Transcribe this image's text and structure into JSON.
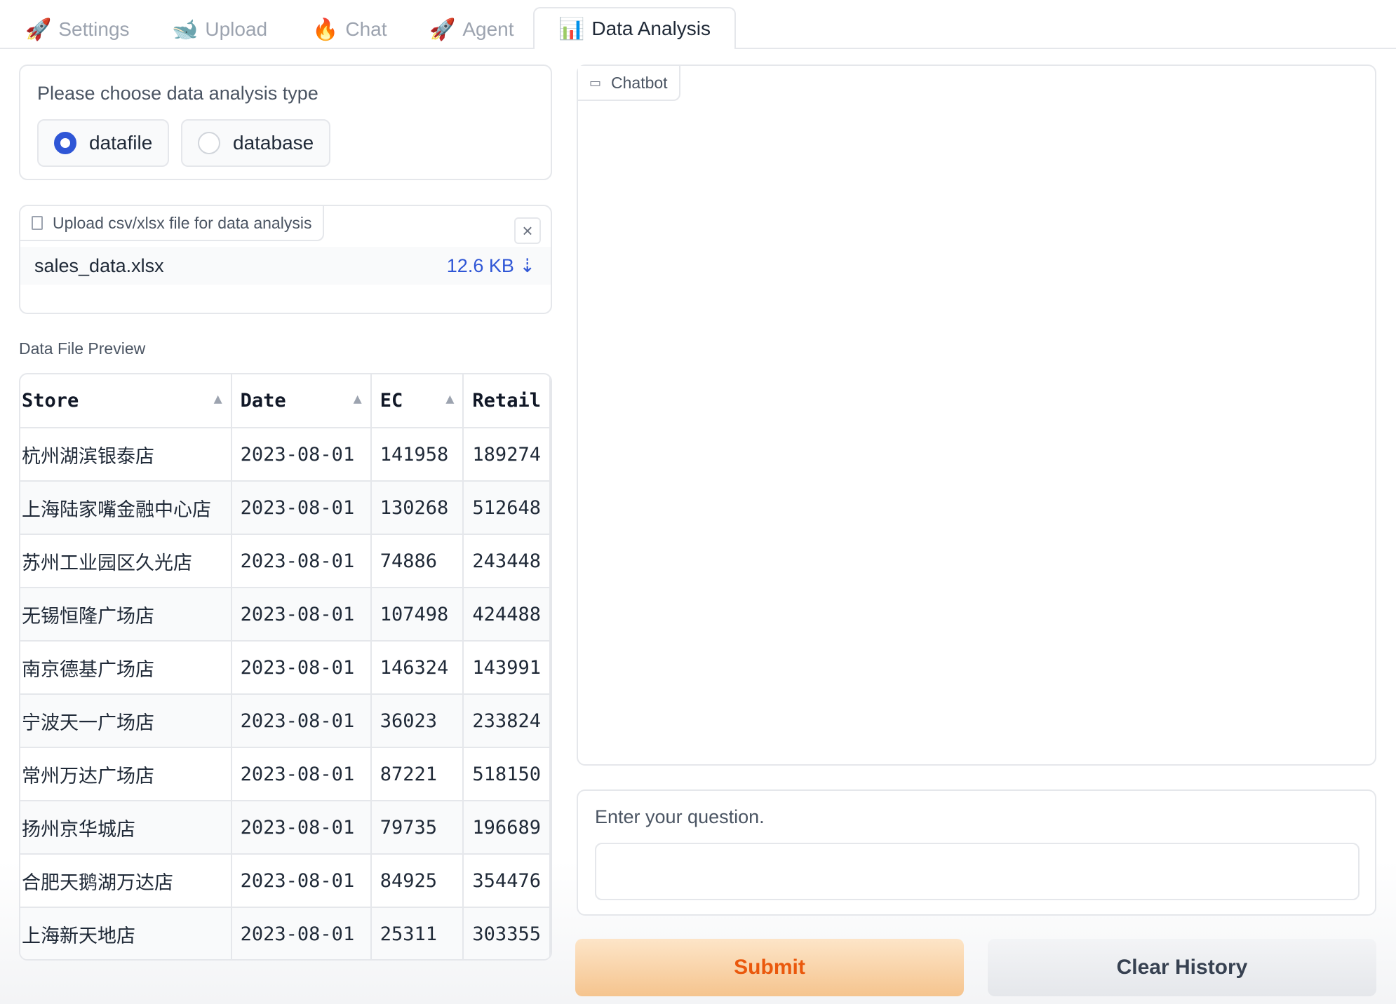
{
  "tabs": [
    {
      "label": "Settings",
      "icon": "rocket-icon",
      "glyph": "🚀"
    },
    {
      "label": "Upload",
      "icon": "whale-icon",
      "glyph": "🐋"
    },
    {
      "label": "Chat",
      "icon": "fire-icon",
      "glyph": "🔥"
    },
    {
      "label": "Agent",
      "icon": "rocket-icon",
      "glyph": "🚀"
    },
    {
      "label": "Data Analysis",
      "icon": "bar-chart-icon",
      "glyph": "📊",
      "active": true
    }
  ],
  "analysis_type": {
    "label": "Please choose data analysis type",
    "options": [
      "datafile",
      "database"
    ],
    "selected": "datafile"
  },
  "upload": {
    "label": "Upload csv/xlsx file for data analysis",
    "file_name": "sales_data.xlsx",
    "file_size": "12.6 KB"
  },
  "preview": {
    "label": "Data File Preview",
    "columns": [
      "Store",
      "Date",
      "EC",
      "Retail"
    ],
    "rows": [
      [
        "杭州湖滨银泰店",
        "2023-08-01",
        "141958",
        "189274"
      ],
      [
        "上海陆家嘴金融中心店",
        "2023-08-01",
        "130268",
        "512648"
      ],
      [
        "苏州工业园区久光店",
        "2023-08-01",
        "74886",
        "243448"
      ],
      [
        "无锡恒隆广场店",
        "2023-08-01",
        "107498",
        "424488"
      ],
      [
        "南京德基广场店",
        "2023-08-01",
        "146324",
        "143991"
      ],
      [
        "宁波天一广场店",
        "2023-08-01",
        "36023",
        "233824"
      ],
      [
        "常州万达广场店",
        "2023-08-01",
        "87221",
        "518150"
      ],
      [
        "扬州京华城店",
        "2023-08-01",
        "79735",
        "196689"
      ],
      [
        "合肥天鹅湖万达店",
        "2023-08-01",
        "84925",
        "354476"
      ],
      [
        "上海新天地店",
        "2023-08-01",
        "25311",
        "303355"
      ]
    ]
  },
  "chatbot": {
    "label": "Chatbot"
  },
  "question": {
    "label": "Enter your question.",
    "value": ""
  },
  "buttons": {
    "submit": "Submit",
    "clear": "Clear History"
  },
  "colors": {
    "accent": "#2f56d6",
    "submit_text": "#ea580c"
  }
}
